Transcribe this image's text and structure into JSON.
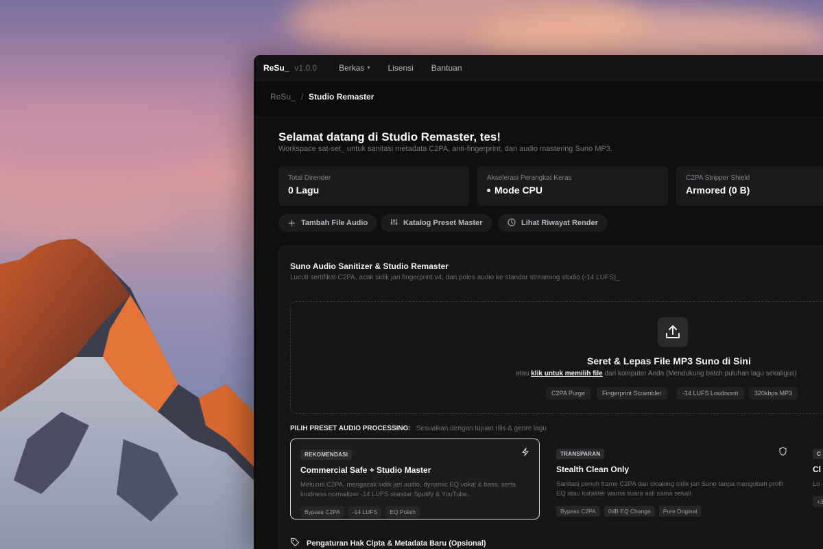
{
  "menubar": {
    "brand": "ReSu_",
    "version": "v1.0.0",
    "items": [
      {
        "label": "Berkas",
        "has_dropdown": true
      },
      {
        "label": "Lisensi"
      },
      {
        "label": "Bantuan"
      }
    ]
  },
  "breadcrumb": {
    "root": "ReSu_",
    "separator": "/",
    "current": "Studio Remaster"
  },
  "welcome": {
    "title": "Selamat datang di Studio Remaster, tes!",
    "subtitle": "Workspace sat-set_ untuk sanitasi metadata C2PA, anti-fingerprint, dan audio mastering Suno MP3."
  },
  "stats": [
    {
      "label": "Total Dirender",
      "value": "0 Lagu"
    },
    {
      "label": "Akselerasi Perangkat Keras",
      "value": "Mode CPU"
    },
    {
      "label": "C2PA Stripper Shield",
      "value": "Armored (0 B)"
    }
  ],
  "actions": [
    {
      "label": "Tambah File Audio",
      "icon": "plus-icon"
    },
    {
      "label": "Katalog Preset Master",
      "icon": "sliders-icon"
    },
    {
      "label": "Lihat Riwayat Render",
      "icon": "clock-icon"
    }
  ],
  "sanitizer": {
    "title": "Suno Audio Sanitizer & Studio Remaster",
    "subtitle": "Lucuti sertifikat C2PA, acak sidik jari fingerprint.v4, dan poles audio ke standar streaming studio (-14 LUFS)_",
    "drop_title": "Seret & Lepas File MP3 Suno di Sini",
    "drop_prefix": "atau",
    "drop_link": "klik untuk memilih file",
    "drop_suffix": "dari komputer Anda (Mendukung batch puluhan lagu sekaligus)",
    "chips": [
      "C2PA Purge",
      "Fingerprint Scrambler",
      "-14 LUFS Loudnorm",
      "320kbps MP3"
    ]
  },
  "presets_header": {
    "title": "PILIH PRESET AUDIO PROCESSING:",
    "hint": "Sesuaikan dengan tujuan rilis & genre lagu"
  },
  "presets": [
    {
      "badge": "REKOMENDASI",
      "icon": "bolt-icon",
      "title": "Commercial Safe + Studio Master",
      "desc": "Melucuti C2PA, mengacak sidik jari audio, dynamic EQ vokal & bass, serta loudness normalizer -14 LUFS standar Spotify & YouTube.",
      "tags": [
        "Bypass C2PA",
        "-14 LUFS",
        "EQ Polish"
      ],
      "selected": true
    },
    {
      "badge": "TRANSPARAN",
      "icon": "shield-icon",
      "title": "Stealth Clean Only",
      "desc": "Sanitasi penuh frame C2PA dan cloaking sidik jari Suno tanpa mengubah profil EQ atau karakter warna suara asli sama sekali.",
      "tags": [
        "Bypass C2PA",
        "0dB EQ Change",
        "Pure Original"
      ],
      "selected": false
    },
    {
      "badge": "C",
      "icon": "",
      "title": "Cl",
      "desc": "Lo",
      "tags": [
        "+3"
      ],
      "selected": false
    }
  ],
  "copyright": {
    "label": "Pengaturan Hak Cipta & Metadata Baru (Opsional)"
  }
}
